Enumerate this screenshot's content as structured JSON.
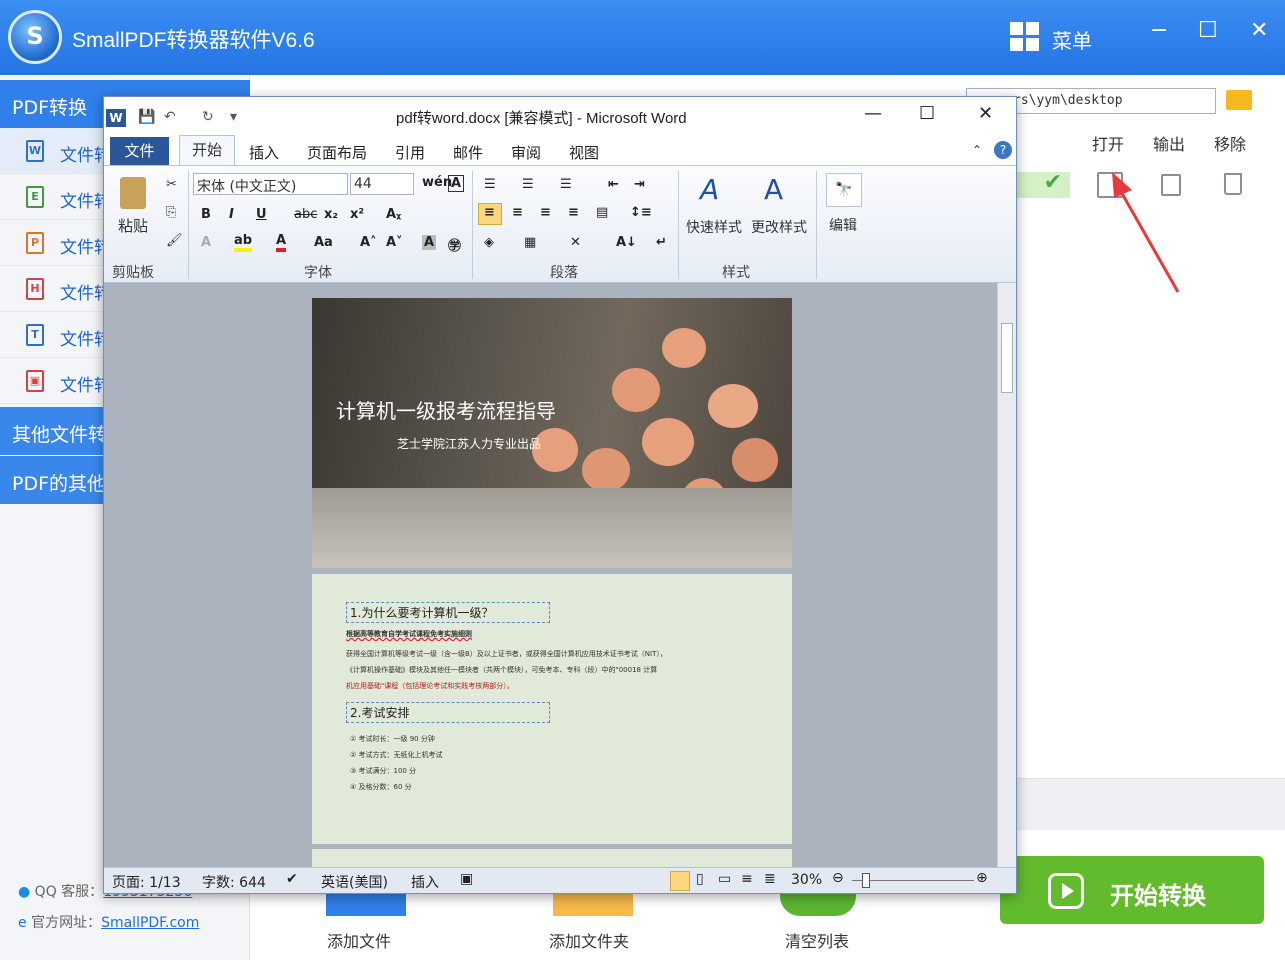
{
  "app": {
    "title": "SmallPDF转换器软件V6.6",
    "logo_letter": "S",
    "menu_label": "菜单",
    "minimize": "−",
    "maximize": "☐",
    "close": "✕"
  },
  "sidebar": {
    "head1": "PDF转换",
    "items": [
      {
        "label": "文件转",
        "icon": "W",
        "color": "#2f6fcd"
      },
      {
        "label": "文件转",
        "icon": "E",
        "color": "#3f9a45"
      },
      {
        "label": "文件转",
        "icon": "P",
        "color": "#d9762b"
      },
      {
        "label": "文件转",
        "icon": "H",
        "color": "#d94040"
      },
      {
        "label": "文件转",
        "icon": "T",
        "color": "#2f6fcd"
      },
      {
        "label": "文件转",
        "icon": "▣",
        "color": "#d94040"
      }
    ],
    "head2": "其他文件转",
    "head3": "PDF的其他",
    "qq_label": "QQ 客服：",
    "qq_value": "1993173256",
    "web_label": "官方网址：",
    "web_value": "SmallPDF.com"
  },
  "list": {
    "path": "rs\\yym\\desktop",
    "col_open": "打开",
    "col_output": "输出",
    "col_remove": "移除",
    "status_icon": "check-icon"
  },
  "bottom": {
    "add_file": "添加文件",
    "add_folder": "添加文件夹",
    "clear_list": "清空列表",
    "start": "开始转换"
  },
  "word": {
    "title": "pdf转word.docx [兼容模式] - Microsoft Word",
    "tabs": {
      "file": "文件",
      "home": "开始",
      "insert": "插入",
      "layout": "页面布局",
      "references": "引用",
      "mailings": "邮件",
      "review": "审阅",
      "view": "视图"
    },
    "ribbon": {
      "paste": "粘贴",
      "clipboard": "剪贴板",
      "font_name": "宋体 (中文正文)",
      "font_size": "44",
      "font": "字体",
      "paragraph": "段落",
      "quick_styles": "快速样式",
      "change_styles": "更改样式",
      "styles": "样式",
      "edit": "编辑"
    },
    "doc": {
      "cover_title": "计算机一级报考流程指导",
      "cover_sub": "芝士学院江苏人力专业出品",
      "h1": "1.为什么要考计算机一级？",
      "p1": "根据高等教育自学考试课程免考实施细则",
      "p2": "获得全国计算机等级考试一级（含一级B）及以上证书者，或获得全国计算机应用技术证书考试（NIT），",
      "p3": "《计算机操作基础》模块及其他任一模块者（共两个模块），可免考本、专科（段）中的\"00018 计算",
      "p4": "机应用基础\"课程（包括理论考试和实践考核两部分）。",
      "h2": "2.考试安排",
      "li1": "①  考试时长：一级 90 分钟",
      "li2": "②  考试方式：无纸化上机考试",
      "li3": "③  考试满分：100 分",
      "li4": "④  及格分数：60 分"
    },
    "status": {
      "page": "页面: 1/13",
      "words": "字数: 644",
      "lang": "英语(美国)",
      "mode": "插入",
      "zoom": "30%"
    }
  }
}
